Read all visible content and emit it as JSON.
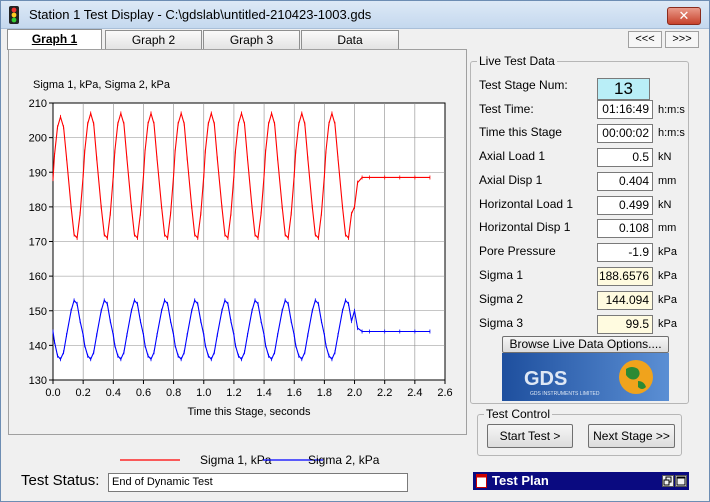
{
  "window": {
    "title": "Station 1 Test Display - C:\\gdslab\\untitled-210423-1003.gds",
    "close_label": "✕"
  },
  "tabs": [
    {
      "label": "Graph 1"
    },
    {
      "label": "Graph 2"
    },
    {
      "label": "Graph 3"
    },
    {
      "label": "Data"
    }
  ],
  "nav": {
    "prev": "<<<",
    "next": ">>>"
  },
  "graph": {
    "ylabel": "Sigma 1, kPa, Sigma 2, kPa",
    "xlabel": "Time this Stage, seconds",
    "legend": [
      {
        "name": "Sigma 1, kPa",
        "color": "#ff0000"
      },
      {
        "name": "Sigma 2, kPa",
        "color": "#0000ff"
      }
    ]
  },
  "chart_data": {
    "type": "line",
    "xlabel": "Time this Stage, seconds",
    "ylabel": "Sigma 1, kPa, Sigma 2, kPa",
    "xlim": [
      0.0,
      2.6
    ],
    "ylim": [
      130,
      210
    ],
    "xticks": [
      "0.0",
      "0.2",
      "0.4",
      "0.6",
      "0.8",
      "1.0",
      "1.2",
      "1.4",
      "1.6",
      "1.8",
      "2.0",
      "2.2",
      "2.4",
      "2.6"
    ],
    "yticks": [
      "130",
      "140",
      "150",
      "160",
      "170",
      "180",
      "190",
      "200",
      "210"
    ],
    "grid": true,
    "legend_position": "bottom",
    "series": [
      {
        "name": "Sigma 1, kPa",
        "color": "#ff0000",
        "x": [
          0.0,
          0.01,
          0.03,
          0.05,
          0.07,
          0.09,
          0.12,
          0.14,
          0.16,
          0.18,
          0.2,
          0.21,
          0.23,
          0.25,
          0.27,
          0.29,
          0.32,
          0.34,
          0.36,
          0.38,
          0.4,
          0.41,
          0.43,
          0.45,
          0.47,
          0.49,
          0.52,
          0.54,
          0.56,
          0.58,
          0.6,
          0.61,
          0.63,
          0.65,
          0.67,
          0.69,
          0.72,
          0.74,
          0.76,
          0.78,
          0.8,
          0.81,
          0.83,
          0.85,
          0.87,
          0.89,
          0.92,
          0.94,
          0.96,
          0.98,
          1.0,
          1.01,
          1.03,
          1.05,
          1.07,
          1.09,
          1.12,
          1.14,
          1.16,
          1.18,
          1.2,
          1.21,
          1.23,
          1.25,
          1.27,
          1.29,
          1.32,
          1.34,
          1.36,
          1.38,
          1.4,
          1.41,
          1.43,
          1.45,
          1.47,
          1.49,
          1.52,
          1.54,
          1.56,
          1.58,
          1.6,
          1.61,
          1.63,
          1.65,
          1.67,
          1.69,
          1.72,
          1.74,
          1.76,
          1.78,
          1.8,
          1.81,
          1.83,
          1.85,
          1.87,
          1.89,
          1.92,
          1.94,
          1.96,
          1.98,
          2.0,
          2.02,
          2.05,
          2.1,
          2.2,
          2.3,
          2.4,
          2.5
        ],
        "values": [
          188,
          195,
          203,
          206,
          203,
          194,
          180,
          172,
          171,
          178,
          189,
          196,
          204,
          207,
          204,
          194,
          180,
          172,
          171,
          178,
          189,
          196,
          204,
          207,
          204,
          194,
          180,
          172,
          171,
          178,
          189,
          196,
          204,
          207,
          204,
          194,
          180,
          172,
          171,
          178,
          189,
          196,
          204,
          207,
          204,
          194,
          180,
          172,
          171,
          178,
          189,
          196,
          204,
          207,
          204,
          194,
          180,
          172,
          171,
          178,
          189,
          196,
          204,
          207,
          204,
          194,
          180,
          172,
          171,
          178,
          189,
          196,
          204,
          207,
          204,
          194,
          180,
          172,
          171,
          178,
          189,
          196,
          204,
          207,
          204,
          194,
          180,
          172,
          171,
          178,
          189,
          196,
          204,
          207,
          204,
          194,
          180,
          172,
          171,
          178,
          180,
          187,
          188.5,
          188.5,
          188.5,
          188.5,
          188.5,
          188.5
        ]
      },
      {
        "name": "Sigma 2, kPa",
        "color": "#0000ff",
        "x": [
          0.0,
          0.01,
          0.03,
          0.05,
          0.07,
          0.09,
          0.12,
          0.14,
          0.16,
          0.18,
          0.2,
          0.21,
          0.23,
          0.25,
          0.27,
          0.29,
          0.32,
          0.34,
          0.36,
          0.38,
          0.4,
          0.41,
          0.43,
          0.45,
          0.47,
          0.49,
          0.52,
          0.54,
          0.56,
          0.58,
          0.6,
          0.61,
          0.63,
          0.65,
          0.67,
          0.69,
          0.72,
          0.74,
          0.76,
          0.78,
          0.8,
          0.81,
          0.83,
          0.85,
          0.87,
          0.89,
          0.92,
          0.94,
          0.96,
          0.98,
          1.0,
          1.01,
          1.03,
          1.05,
          1.07,
          1.09,
          1.12,
          1.14,
          1.16,
          1.18,
          1.2,
          1.21,
          1.23,
          1.25,
          1.27,
          1.29,
          1.32,
          1.34,
          1.36,
          1.38,
          1.4,
          1.41,
          1.43,
          1.45,
          1.47,
          1.49,
          1.52,
          1.54,
          1.56,
          1.58,
          1.6,
          1.61,
          1.63,
          1.65,
          1.67,
          1.69,
          1.72,
          1.74,
          1.76,
          1.78,
          1.8,
          1.81,
          1.83,
          1.85,
          1.87,
          1.89,
          1.92,
          1.94,
          1.96,
          1.98,
          2.0,
          2.02,
          2.05,
          2.1,
          2.2,
          2.3,
          2.4,
          2.5
        ],
        "values": [
          144,
          141,
          137,
          136,
          138,
          143,
          150,
          153,
          152,
          147,
          143,
          140,
          137,
          136,
          138,
          143,
          150,
          153,
          152,
          147,
          143,
          140,
          137,
          136,
          138,
          143,
          150,
          153,
          152,
          147,
          143,
          140,
          137,
          136,
          138,
          143,
          150,
          153,
          152,
          147,
          143,
          140,
          137,
          136,
          138,
          143,
          150,
          153,
          152,
          147,
          143,
          140,
          137,
          136,
          138,
          143,
          150,
          153,
          152,
          147,
          143,
          140,
          137,
          136,
          138,
          143,
          150,
          153,
          152,
          147,
          143,
          140,
          137,
          136,
          138,
          143,
          150,
          153,
          152,
          147,
          143,
          140,
          137,
          136,
          138,
          143,
          150,
          153,
          152,
          147,
          143,
          140,
          137,
          136,
          138,
          143,
          150,
          153,
          152,
          147,
          150,
          145,
          144,
          144,
          144,
          144,
          144,
          144
        ]
      }
    ]
  },
  "live": {
    "title": "Live Test Data",
    "stage_num_label": "Test Stage Num:",
    "stage_num": "13",
    "rows": [
      {
        "label": "Test Time:",
        "value": "01:16:49",
        "unit": "h:m:s"
      },
      {
        "label": "Time this Stage",
        "value": "00:00:02",
        "unit": "h:m:s"
      },
      {
        "label": "Axial Load 1",
        "value": "0.5",
        "unit": "kN"
      },
      {
        "label": "Axial Disp 1",
        "value": "0.404",
        "unit": "mm"
      },
      {
        "label": "Horizontal Load 1",
        "value": "0.499",
        "unit": "kN"
      },
      {
        "label": "Horizontal Disp 1",
        "value": "0.108",
        "unit": "mm"
      },
      {
        "label": "Pore Pressure",
        "value": "-1.9",
        "unit": "kPa"
      },
      {
        "label": "Sigma 1",
        "value": "188.6576",
        "unit": "kPa"
      },
      {
        "label": "Sigma 2",
        "value": "144.094",
        "unit": "kPa"
      },
      {
        "label": "Sigma 3",
        "value": "99.5",
        "unit": "kPa"
      }
    ],
    "browse_button": "Browse Live Data Options...."
  },
  "logo": {
    "text": "GDS",
    "subtext": "GDS INSTRUMENTS LIMITED"
  },
  "test_control": {
    "title": "Test Control",
    "start": "Start Test >",
    "next": "Next Stage >>"
  },
  "status": {
    "label": "Test Status:",
    "value": "End of Dynamic Test"
  },
  "test_plan": {
    "title": "Test Plan"
  },
  "colors": {
    "titlebar": "#c4d8ee",
    "stage_bg": "#b9eef7",
    "sigma_bg": "#fffbe0",
    "plan_bar": "#0a0a80"
  }
}
